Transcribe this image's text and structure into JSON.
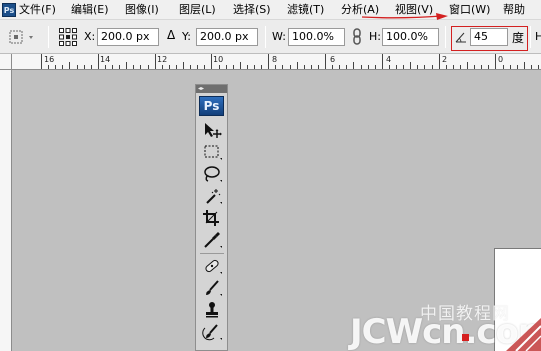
{
  "app": {
    "badge": "Ps"
  },
  "menubar": {
    "items": [
      "文件(F)",
      "编辑(E)",
      "图像(I)",
      "图层(L)",
      "选择(S)",
      "滤镜(T)",
      "分析(A)",
      "视图(V)",
      "窗口(W)",
      "帮助"
    ]
  },
  "options": {
    "x_label": "X:",
    "x_value": "200.0 px",
    "delta_label": "Δ",
    "y_label": "Y:",
    "y_value": "200.0 px",
    "w_label": "W:",
    "w_value": "100.0%",
    "h_label": "H:",
    "h_value": "100.0%",
    "angle_value": "45",
    "angle_unit": "度",
    "trailing_label": "H"
  },
  "ruler": {
    "numbers": [
      "16",
      "14",
      "12",
      "10",
      "8",
      "6",
      "4",
      "2",
      "0"
    ]
  },
  "toolbox": {
    "badge": "Ps",
    "tools": [
      "move-tool-icon",
      "marquee-tool-icon",
      "lasso-tool-icon",
      "magic-wand-tool-icon",
      "crop-tool-icon",
      "eyedropper-tool-icon",
      "healing-brush-tool-icon",
      "brush-tool-icon",
      "clone-stamp-tool-icon",
      "history-brush-tool-icon"
    ]
  },
  "watermark": {
    "chinese": "中国教程网",
    "english": "JCWcn.com"
  },
  "colors": {
    "highlight": "#d32020",
    "ps_blue": "#1c4f8a",
    "canvas_bg": "#c0c0c0"
  }
}
